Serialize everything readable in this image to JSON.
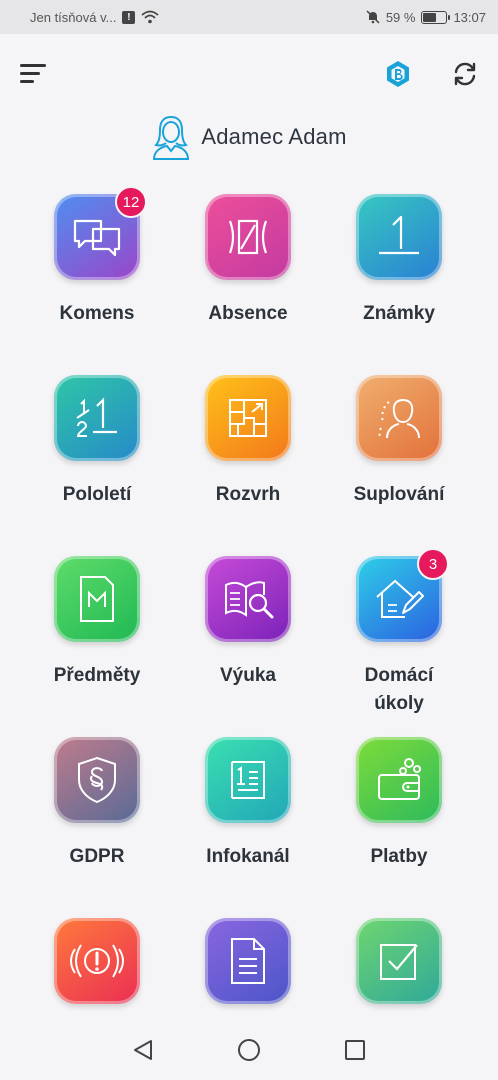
{
  "status": {
    "carrier": "Jen tísňová v...",
    "alert": "!",
    "battery": "59 %",
    "battery_level": 0.59,
    "time": "13:07"
  },
  "user": {
    "name": "Adamec Adam"
  },
  "tiles": [
    {
      "label": "Komens",
      "badge": "12",
      "icon": "chat-bubbles-icon",
      "colors": [
        "#4f8ff0",
        "#9b45c8"
      ]
    },
    {
      "label": "Absence",
      "badge": "",
      "icon": "absence-icon",
      "colors": [
        "#ee4f9a",
        "#c23aa0"
      ]
    },
    {
      "label": "Známky",
      "badge": "",
      "icon": "grade-one-icon",
      "colors": [
        "#37c9c0",
        "#2a7fd4"
      ]
    },
    {
      "label": "Pololetí",
      "badge": "",
      "icon": "half-year-icon",
      "colors": [
        "#2fc7a6",
        "#2689c9"
      ]
    },
    {
      "label": "Rozvrh",
      "badge": "",
      "icon": "timetable-icon",
      "colors": [
        "#ffc21a",
        "#f2781b"
      ]
    },
    {
      "label": "Suplování",
      "badge": "",
      "icon": "substitution-icon",
      "colors": [
        "#f0b070",
        "#e2703a"
      ]
    },
    {
      "label": "Předměty",
      "badge": "",
      "icon": "subjects-icon",
      "colors": [
        "#5fdc6a",
        "#1fb854"
      ]
    },
    {
      "label": "Výuka",
      "badge": "",
      "icon": "lesson-search-icon",
      "colors": [
        "#c84bd8",
        "#7a22b8"
      ]
    },
    {
      "label": "Domácí",
      "label2": "úkoly",
      "badge": "3",
      "icon": "homework-icon",
      "colors": [
        "#2ed0e8",
        "#2c5fe0"
      ]
    },
    {
      "label": "GDPR",
      "badge": "",
      "icon": "shield-paragraph-icon",
      "colors": [
        "#c07c8c",
        "#586a96"
      ]
    },
    {
      "label": "Infokanál",
      "badge": "",
      "icon": "infochannel-icon",
      "colors": [
        "#3ae0b0",
        "#22a6b8"
      ]
    },
    {
      "label": "Platby",
      "badge": "",
      "icon": "wallet-icon",
      "colors": [
        "#7fdc3a",
        "#2cba5c"
      ]
    },
    {
      "label": "",
      "badge": "",
      "icon": "alert-icon",
      "colors": [
        "#ff7a3c",
        "#ea2e54"
      ]
    },
    {
      "label": "",
      "badge": "",
      "icon": "document-icon",
      "colors": [
        "#8a66e0",
        "#4b56c8"
      ]
    },
    {
      "label": "",
      "badge": "",
      "icon": "checkbox-icon",
      "colors": [
        "#6fd66f",
        "#2fa89a"
      ]
    }
  ]
}
